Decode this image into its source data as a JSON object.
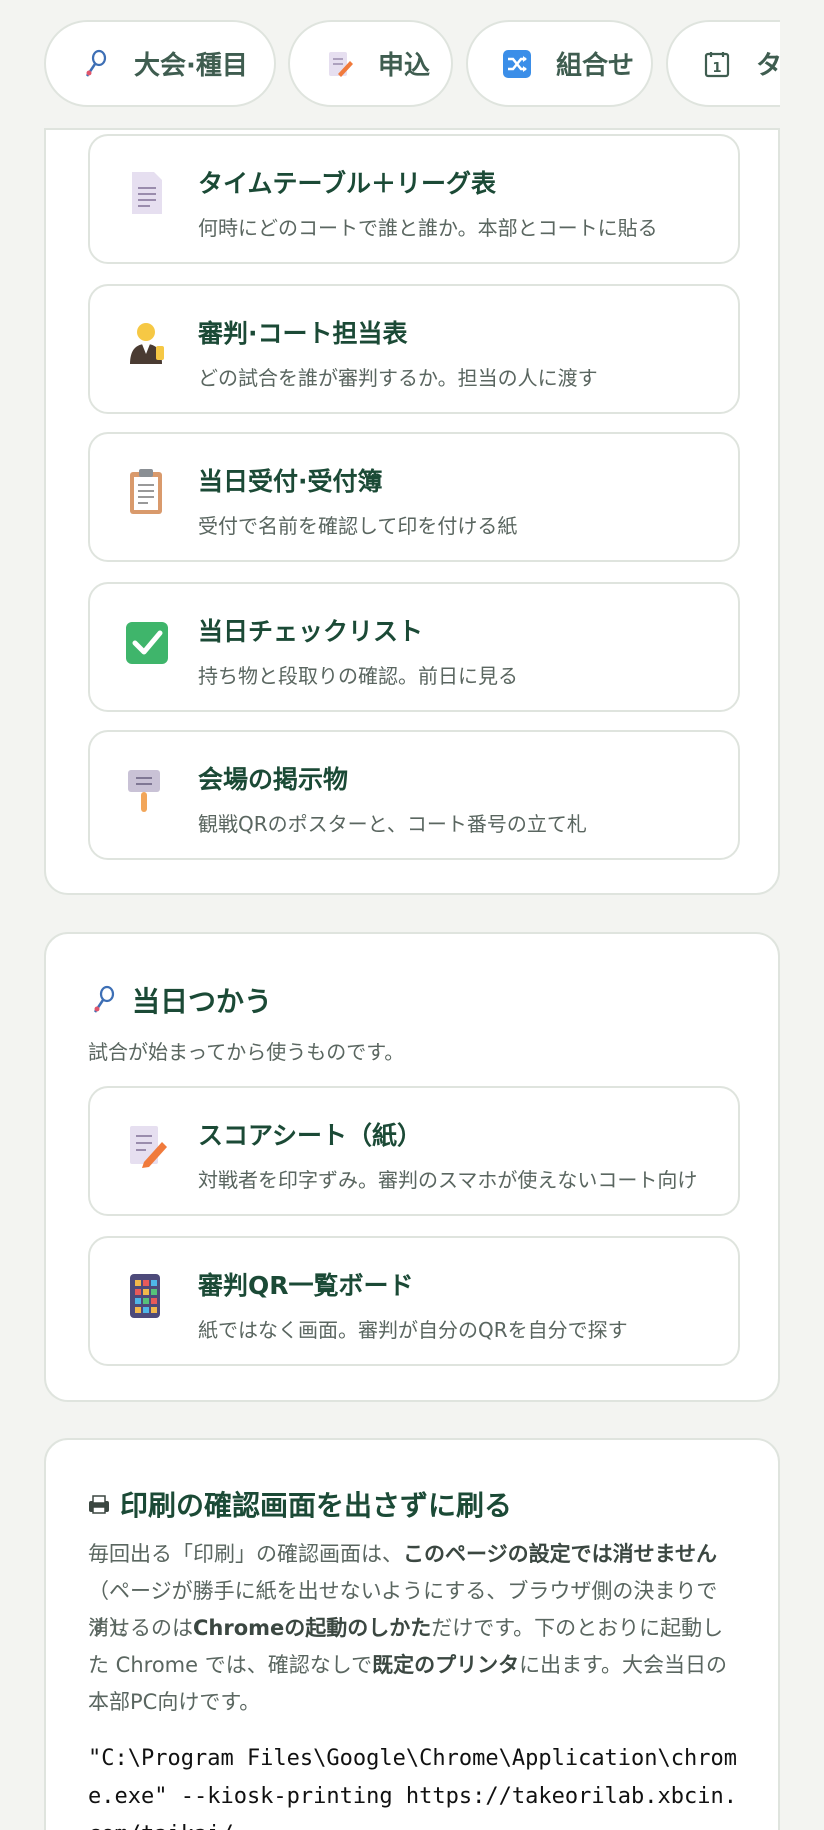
{
  "tabs": [
    {
      "label": "大会·種目",
      "icon": "badminton-icon"
    },
    {
      "label": "申込",
      "icon": "memo-icon"
    },
    {
      "label": "組合せ",
      "icon": "shuffle-icon"
    },
    {
      "label": "タイ",
      "icon": "calendar-icon"
    }
  ],
  "print_section": {
    "items": [
      {
        "title": "タイムテーブル＋リーグ表",
        "desc": "何時にどのコートで誰と誰か。本部とコートに貼る",
        "icon": "document-icon"
      },
      {
        "title": "審判·コート担当表",
        "desc": "どの試合を誰が審判するか。担当の人に渡す",
        "icon": "referee-icon"
      },
      {
        "title": "当日受付·受付簿",
        "desc": "受付で名前を確認して印を付ける紙",
        "icon": "clipboard-icon"
      },
      {
        "title": "当日チェックリスト",
        "desc": "持ち物と段取りの確認。前日に見る",
        "icon": "checkmark-icon"
      },
      {
        "title": "会場の掲示物",
        "desc": "観戦QRのポスターと、コート番号の立て札",
        "icon": "placard-icon"
      }
    ]
  },
  "day_section": {
    "title": "当日つかう",
    "subtitle": "試合が始まってから使うものです。",
    "items": [
      {
        "title": "スコアシート（紙）",
        "desc": "対戦者を印字ずみ。審判のスマホが使えないコート向け",
        "icon": "memo-icon"
      },
      {
        "title": "審判QR一覧ボード",
        "desc": "紙ではなく画面。審判が自分のQRを自分で探す",
        "icon": "calculator-icon"
      }
    ]
  },
  "kiosk_section": {
    "title": "印刷の確認画面を出さずに刷る",
    "p1_a": "毎回出る「印刷」の確認画面は、",
    "p1_b": "このページの設定では消せません",
    "p1_c": "（ページが勝手に紙を出せないようにする、ブラウザ側の決まりです）。",
    "p2_a": "消せるのは",
    "p2_b": "Chromeの起動のしかた",
    "p2_c": "だけです。下のとおりに起動した Chrome では、確認なしで",
    "p2_d": "既定のプリンタ",
    "p2_e": "に出ます。大会当日の本部PC向けです。",
    "command": "\"C:\\Program Files\\Google\\Chrome\\Application\\chrome.exe\" --kiosk-printing https://takeorilab.xbcin.com/taikai/"
  }
}
